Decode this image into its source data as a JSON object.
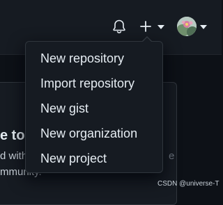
{
  "header": {
    "icons": [
      "bell-icon",
      "plus-icon",
      "caret-down-icon",
      "avatar"
    ]
  },
  "background": {
    "welcome_partial": "e to t",
    "body_line1": "d with",
    "body_line2": "mmunity.",
    "body_tail": "e"
  },
  "create_menu": {
    "items": [
      {
        "label": "New repository"
      },
      {
        "label": "Import repository"
      },
      {
        "label": "New gist"
      },
      {
        "label": "New organization"
      },
      {
        "label": "New project"
      }
    ]
  },
  "watermark": "CSDN @universe-T",
  "colors": {
    "header_bg": "#161b22",
    "page_bg": "#0d1117",
    "menu_bg": "#161b22",
    "border": "#30363d",
    "text": "#e6edf3"
  }
}
